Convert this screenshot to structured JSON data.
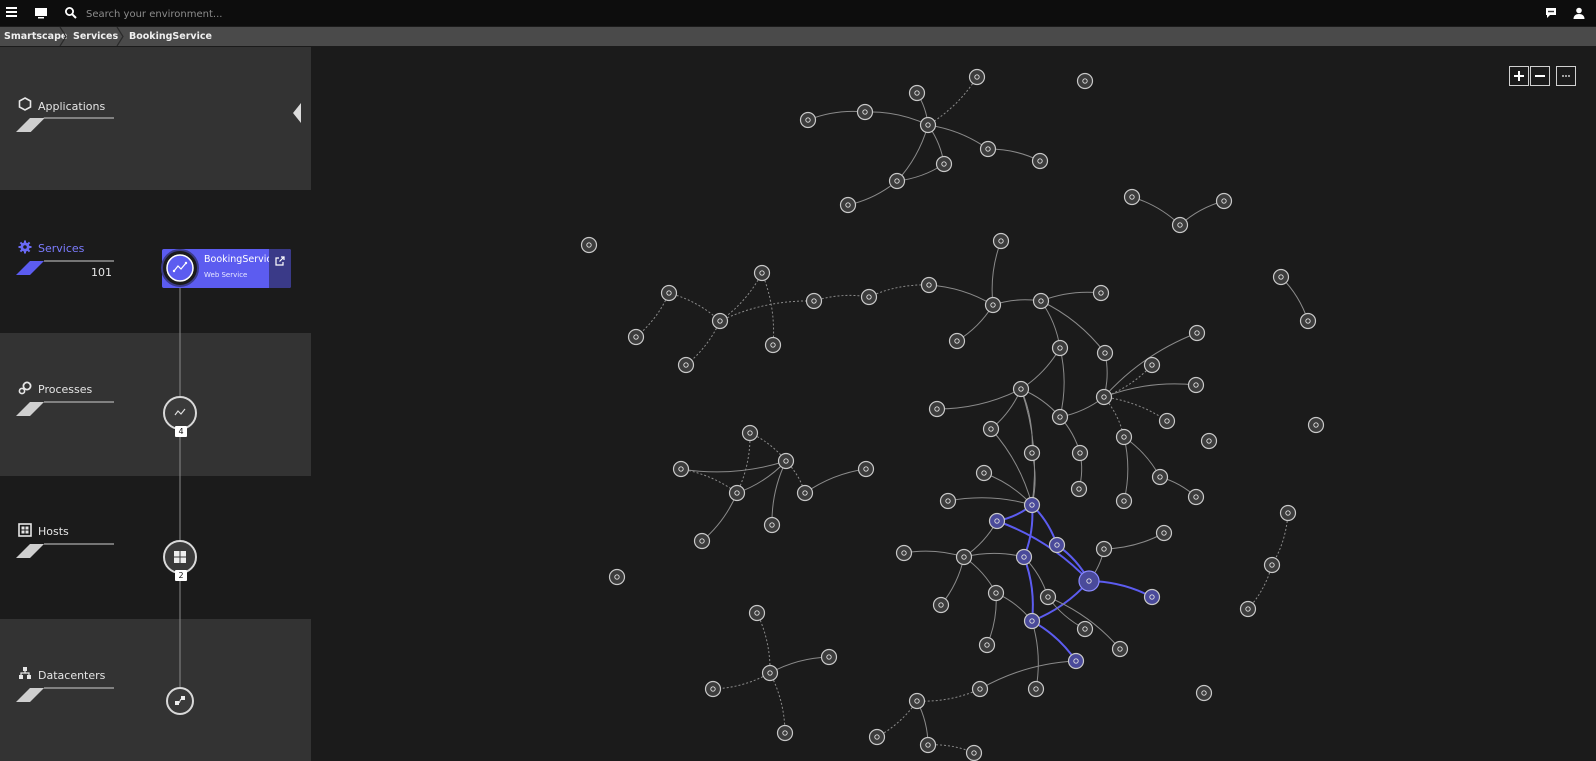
{
  "topbar": {
    "search_placeholder": "Search your environment...",
    "icons": [
      "hamburger-menu-icon",
      "screen-icon",
      "search-icon",
      "chat-icon",
      "user-icon"
    ]
  },
  "breadcrumb": {
    "items": [
      {
        "label": "Smartscape"
      },
      {
        "label": "Services"
      },
      {
        "label": "BookingService"
      }
    ]
  },
  "sidebar": {
    "layers": [
      {
        "label": "Applications",
        "count": null,
        "active": false
      },
      {
        "label": "Services",
        "count": "101",
        "active": true
      },
      {
        "label": "Processes",
        "count": null,
        "active": false
      },
      {
        "label": "Hosts",
        "count": null,
        "active": false
      },
      {
        "label": "Datacenters",
        "count": null,
        "active": false
      }
    ],
    "selected_entity": {
      "name": "BookingService",
      "type": "Web Service"
    },
    "stack_badges": {
      "processes": "4",
      "hosts": "2"
    }
  },
  "colors": {
    "accent": "#5c5cf0",
    "background": "#1b1b1b",
    "topbar": "#0d0d0d",
    "breadcrumb": "#4a4a4a",
    "node_fill": "#3c3c3c",
    "node_stroke": "#c8c8c8",
    "edge": "#8a8a8a",
    "highlight_edge": "#5c5cf0"
  },
  "graph_toolbar": {
    "zoom_in_label": "+",
    "zoom_out_label": "−",
    "more_label": "···"
  }
}
